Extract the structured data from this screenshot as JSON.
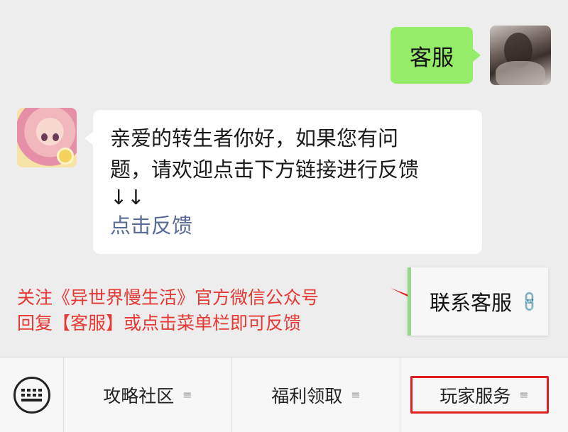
{
  "chat": {
    "outgoing": {
      "text": "客服"
    },
    "incoming": {
      "text_line1": "亲爱的转生者你好，如果您有问",
      "text_line2": "题，请欢迎点击下方链接进行反馈",
      "arrows": "↓↓",
      "link": "点击反馈"
    }
  },
  "caption": {
    "line1": "关注《异世界慢生活》官方微信公众号",
    "line2": "回复【客服】或点击菜单栏即可反馈"
  },
  "popup": {
    "label": "联系客服",
    "icon": "link-icon"
  },
  "menu": {
    "keyboard_icon": "keyboard-icon",
    "items": [
      {
        "label": "攻略社区"
      },
      {
        "label": "福利领取"
      },
      {
        "label": "玩家服务"
      }
    ],
    "menu_indicator": "≡"
  },
  "colors": {
    "accent_green": "#95ec69",
    "link_blue": "#576b95",
    "annotation_red": "#e53935"
  }
}
